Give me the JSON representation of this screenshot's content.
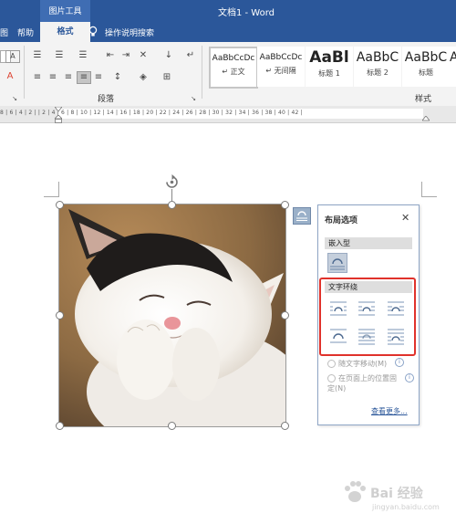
{
  "window": {
    "contextual_group": "图片工具",
    "doc_title": "文档1 - Word",
    "tabs": {
      "left_fragment": "图",
      "help": "帮助",
      "format": "格式",
      "search": "操作说明搜索"
    }
  },
  "ribbon": {
    "paragraph_group": "段落",
    "styles_group": "样式",
    "styles": [
      {
        "sample": "AaBbCcDc",
        "name": "↵ 正文"
      },
      {
        "sample": "AaBbCcDc",
        "name": "↵ 无间隔"
      },
      {
        "sample": "AaBl",
        "name": "标题 1"
      },
      {
        "sample": "AaBbC",
        "name": "标题 2"
      },
      {
        "sample": "AaBbC",
        "name": "标题"
      },
      {
        "sample": "A",
        "name": ""
      }
    ]
  },
  "ruler": {
    "text": "8 | 6 | 4 | 2 |     | 2 | 4 | 6 | 8 | 10 | 12 | 14 | 16 | 18 | 20 | 22 | 24 | 26 | 28 | 30 | 32 | 34 | 36 | 38 | 40 | 42 |"
  },
  "layout_panel": {
    "title": "布局选项",
    "close": "✕",
    "inline_section": "嵌入型",
    "wrap_section": "文字环绕",
    "move_with_text": "随文字移动(M)",
    "fix_position": "在页面上的位置固定(N)",
    "see_more": "查看更多..."
  },
  "watermark": {
    "brand": "Bai 经验",
    "url": "jingyan.baidu.com"
  },
  "colors": {
    "title_bar": "#2b579a",
    "highlight": "#e0322b",
    "panel_border": "#8fa6c6"
  }
}
